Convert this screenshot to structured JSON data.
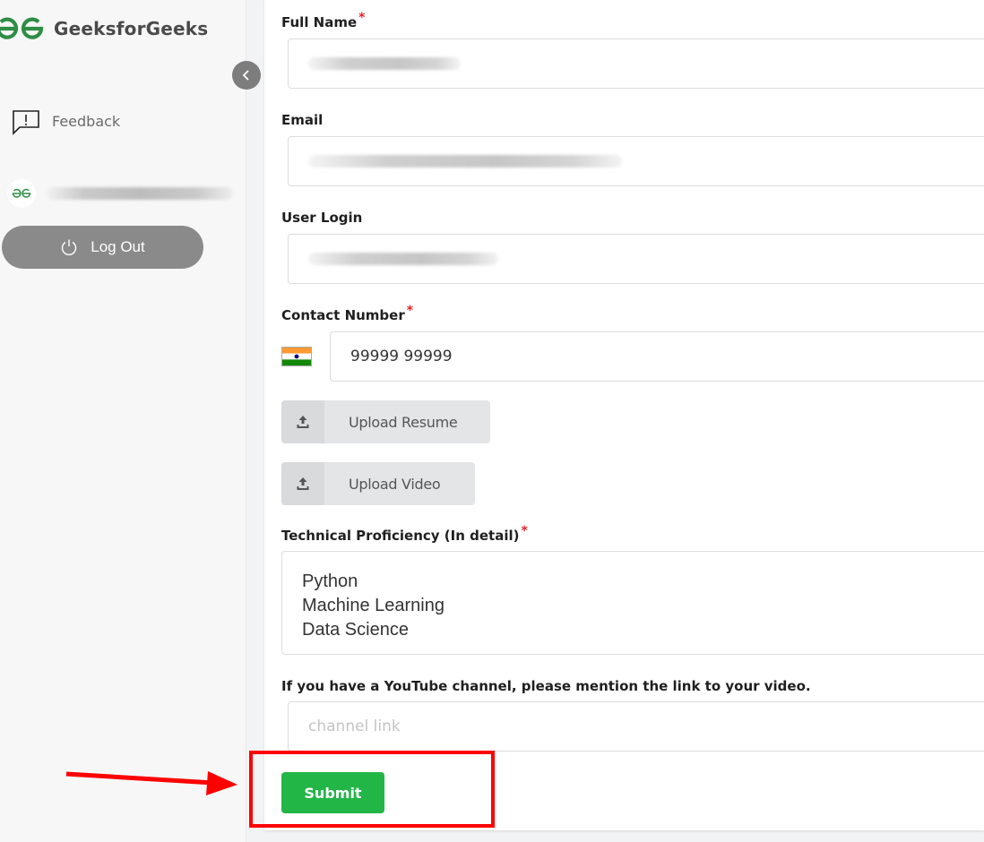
{
  "brand": {
    "name": "GeeksforGeeks",
    "color": "#2f8d46"
  },
  "sidebar": {
    "collapse_icon": "chevron-left-icon",
    "feedback_label": "Feedback",
    "feedback_icon": "feedback-icon",
    "user_name_redacted": true,
    "logout_label": "Log Out",
    "logout_icon": "power-icon"
  },
  "form": {
    "full_name": {
      "label": "Full Name",
      "required": "*",
      "value_redacted": true
    },
    "email": {
      "label": "Email",
      "value_redacted": true
    },
    "user_login": {
      "label": "User Login",
      "value_redacted": true
    },
    "contact_number": {
      "label": "Contact Number",
      "required": "*",
      "country_flag": "India",
      "value": "99999 99999"
    },
    "upload_resume": {
      "label": "Upload Resume",
      "icon": "upload-icon"
    },
    "upload_video": {
      "label": "Upload Video",
      "icon": "upload-icon"
    },
    "technical_proficiency": {
      "label": "Technical Proficiency (In detail)",
      "required": "*",
      "value": "Python\nMachine Learning\nData Science"
    },
    "youtube": {
      "label": "If you have a YouTube channel, please mention the link to your video.",
      "placeholder": "channel link",
      "value": ""
    },
    "submit_label": "Submit"
  },
  "colors": {
    "submit": "#22b646",
    "required": "#e02424",
    "annotation": "#ff0000",
    "logout": "#8a8a8a"
  },
  "annotations": {
    "highlight_target": "Submit",
    "arrow_pointing_to": "Submit"
  }
}
